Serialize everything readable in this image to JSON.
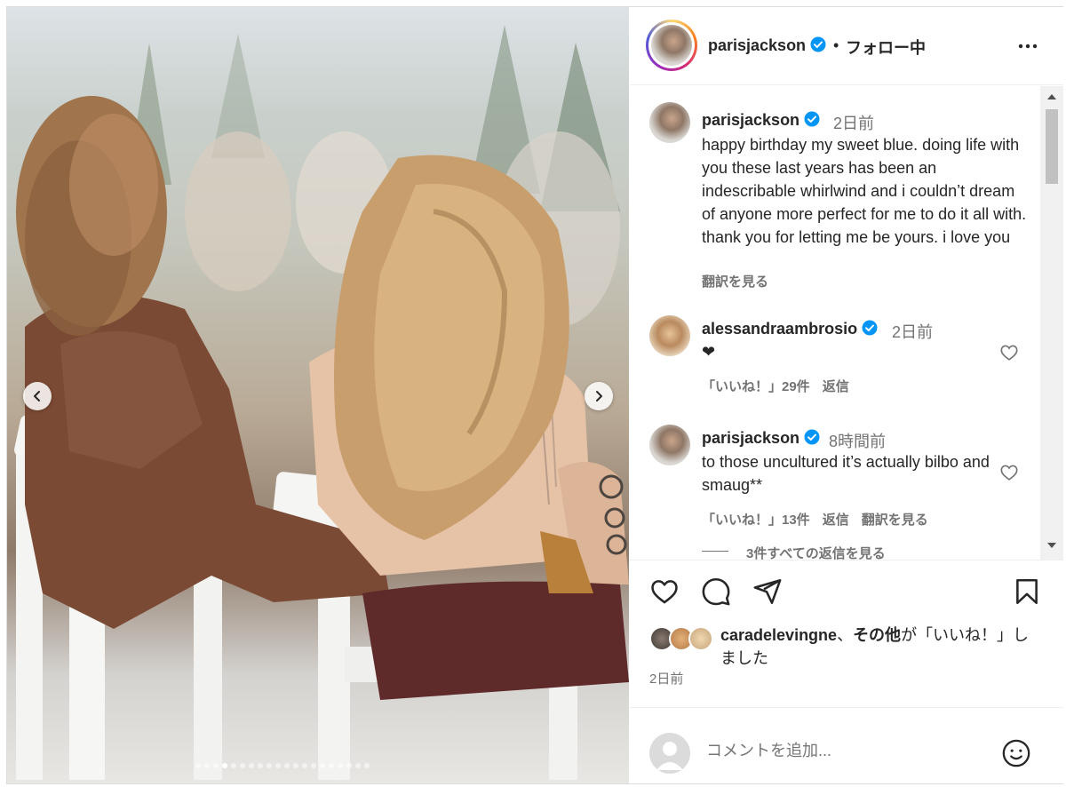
{
  "header": {
    "username": "parisjackson",
    "separator": "•",
    "follow_status": "フォロー中",
    "more_icon": "more-horizontal-icon"
  },
  "caption": {
    "username": "parisjackson",
    "time": "2日前",
    "text": "happy birthday my sweet blue. doing life with you these last years has been an indescribable whirlwind and i couldn’t dream of anyone more perfect for me to do it all with. thank you for letting me be yours. i love you",
    "translate": "翻訳を見る"
  },
  "comments": [
    {
      "username": "alessandraambrosio",
      "time": "2日前",
      "text": "❤",
      "likes": "「いいね！」29件",
      "reply": "返信"
    },
    {
      "username": "parisjackson",
      "time": "8時間前",
      "text": "to those uncultured it’s actually bilbo and smaug**",
      "likes": "「いいね！」13件",
      "reply": "返信",
      "translate": "翻訳を見る"
    }
  ],
  "view_replies": "3件すべての返信を見る",
  "likes": {
    "first_user": "caradelevingne",
    "joiner": "、",
    "others": "その他",
    "suffix": "が「いいね！」しました"
  },
  "post_time": "2日前",
  "add_comment": {
    "placeholder": "コメントを追加..."
  },
  "carousel": {
    "total": 20,
    "active_index": 3
  },
  "colors": {
    "verified": "#0095f6",
    "text": "#262626",
    "muted": "#737373"
  }
}
